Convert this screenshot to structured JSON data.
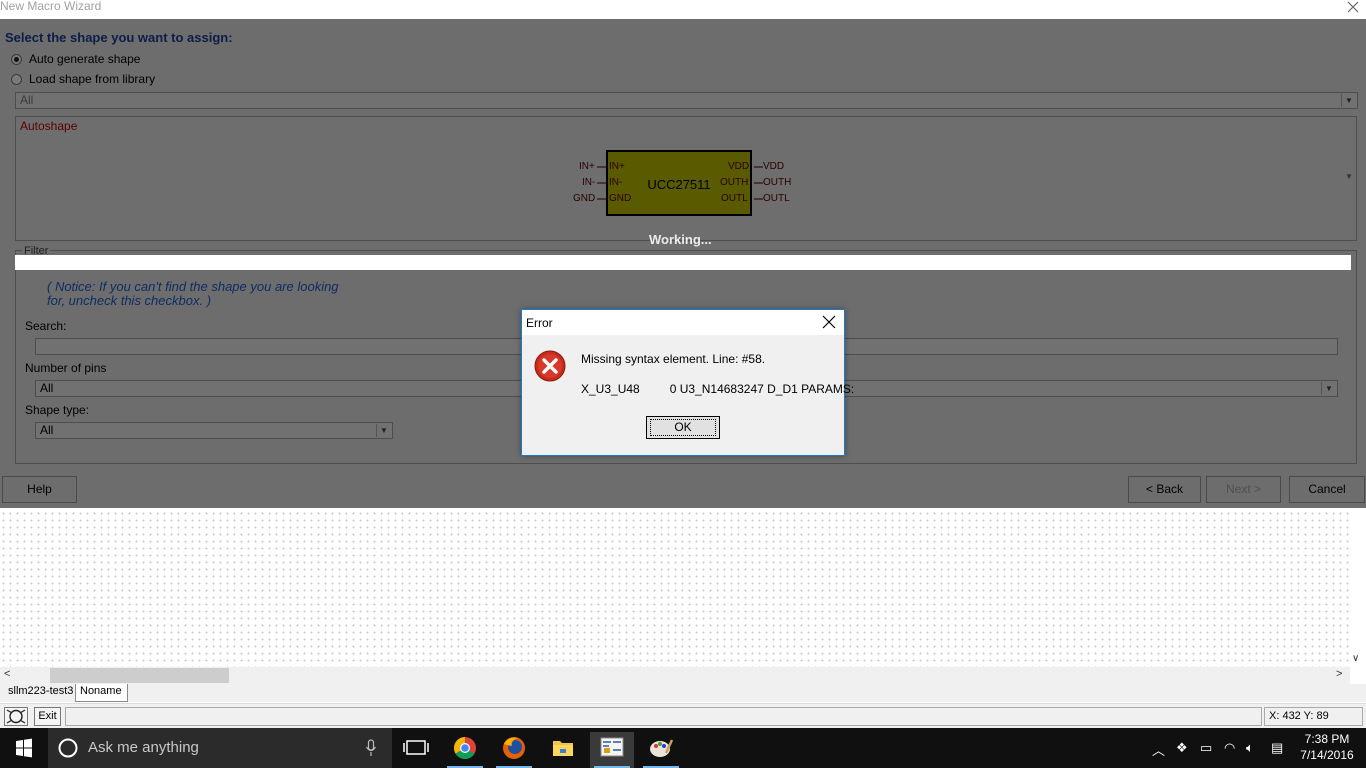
{
  "window": {
    "title": "New Macro Wizard"
  },
  "wizard": {
    "heading": "Select the shape you want to assign:",
    "options": [
      {
        "label": "Auto generate shape",
        "selected": true
      },
      {
        "label": "Load shape from library",
        "selected": false
      }
    ],
    "library_combo": "All",
    "autoshape_label": "Autoshape",
    "symbol": {
      "name": "UCC27511",
      "left_pins": [
        {
          "outer": "IN+",
          "inner": "IN+"
        },
        {
          "outer": "IN-",
          "inner": "IN-"
        },
        {
          "outer": "GND",
          "inner": "GND"
        }
      ],
      "right_pins": [
        {
          "inner": "VDD",
          "outer": "VDD"
        },
        {
          "inner": "OUTH",
          "outer": "OUTH"
        },
        {
          "inner": "OUTL",
          "outer": "OUTL"
        }
      ]
    },
    "working_text": "Working...",
    "filter_label": "Filter",
    "notice_line1": "( Notice: If you can't find the shape you are looking",
    "notice_line2": "for, uncheck this checkbox. )",
    "search_label": "Search:",
    "pins_label": "Number of pins",
    "pins_value": "All",
    "shape_type_label": "Shape type:",
    "shape_type_value": "All",
    "buttons": {
      "help": "Help",
      "back": "< Back",
      "next": "Next >",
      "cancel": "Cancel"
    }
  },
  "error_dialog": {
    "title": "Error",
    "message": "Missing syntax element. Line: #58.",
    "detail": "X_U3_U48         0 U3_N14683247 D_D1 PARAMS:",
    "ok": "OK"
  },
  "tabs": [
    {
      "label": "sllm223-test3",
      "active": false
    },
    {
      "label": "Noname",
      "active": true
    }
  ],
  "statusbar": {
    "exit": "Exit",
    "coords": "X: 432 Y: 89"
  },
  "taskbar": {
    "search_placeholder": "Ask me anything",
    "time": "7:38 PM",
    "date": "7/14/2016",
    "apps": [
      "task-view-icon",
      "chrome-icon",
      "firefox-icon",
      "file-explorer-icon",
      "schematic-app-icon",
      "paint-icon"
    ]
  }
}
